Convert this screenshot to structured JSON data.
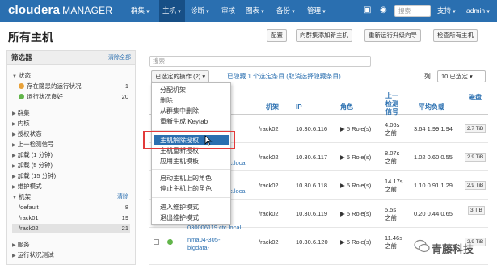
{
  "nav": {
    "brand_bold": "cloudera",
    "brand_rest": "MANAGER",
    "items": [
      "群集",
      "主机",
      "诊断",
      "审核",
      "图表",
      "备份",
      "管理"
    ],
    "search_placeholder": "搜索",
    "support": "支持",
    "user": "admin"
  },
  "page": {
    "title": "所有主机",
    "buttons": [
      "配置",
      "向群集添加新主机",
      "重新运行升级向导",
      "检查所有主机"
    ]
  },
  "sidebar": {
    "header": "筛选器",
    "clear_all": "清除全部",
    "status_label": "状态",
    "status_rows": [
      {
        "label": "存在隐患的运行状况",
        "count": "1",
        "color": "#e8a23a"
      },
      {
        "label": "运行状况良好",
        "count": "20",
        "color": "#62b54a"
      }
    ],
    "groups": [
      "群集",
      "内核",
      "授权状态",
      "上一检测信号",
      "加载 (1 分钟)",
      "加载 (5 分钟)",
      "加载 (15 分钟)",
      "维护模式"
    ],
    "rack_label": "机架",
    "rack_clear": "清除",
    "racks": [
      {
        "label": "/default",
        "count": "8"
      },
      {
        "label": "/rack01",
        "count": "19"
      },
      {
        "label": "/rack02",
        "count": "21"
      }
    ],
    "bottom_groups": [
      "服务",
      "运行状况测试"
    ]
  },
  "main": {
    "search_placeholder": "搜索",
    "actions_button": "已选定的操作 (2)",
    "selection_info": "已隐藏 1 个选定条目 (取消选择隐藏条目)",
    "columns_label": "列",
    "columns_select": "10 已选定"
  },
  "table": {
    "headers": [
      "机架",
      "IP",
      "角色",
      "上一检测信号",
      "平均负载",
      "磁盘"
    ],
    "rows": [
      {
        "host": "",
        "rack": "/rack02",
        "ip": "10.30.6.116",
        "roles": "5 Role(s)",
        "heartbeat": "4.06s 之前",
        "load": "3.64  1.99  1.94",
        "disk": "2.7 TiB"
      },
      {
        "host": "c.local",
        "rack": "/rack02",
        "ip": "10.30.6.117",
        "roles": "5 Role(s)",
        "heartbeat": "8.07s 之前",
        "load": "1.02  0.60  0.55",
        "disk": "2.9 TiB"
      },
      {
        "host": "c.local",
        "rack": "/rack02",
        "ip": "10.30.6.118",
        "roles": "5 Role(s)",
        "heartbeat": "14.17s 之前",
        "load": "1.10  0.91  1.29",
        "disk": "2.9 TiB"
      },
      {
        "host": "bigdata-030006119.ctc.local",
        "rack": "/rack02",
        "ip": "10.30.6.119",
        "roles": "5 Role(s)",
        "heartbeat": "5.5s 之前",
        "load": "0.20  0.44  0.65",
        "disk": "3 TiB"
      },
      {
        "host": "nma04-305-bigdata-",
        "rack": "/rack02",
        "ip": "10.30.6.120",
        "roles": "5 Role(s)",
        "heartbeat": "11.46s 之前",
        "load": "",
        "disk": "2.9 TiB"
      }
    ]
  },
  "dropdown": {
    "items": [
      "分配机架",
      "删除",
      "从群集中删除",
      "重新生成 Keytab",
      "主机解除授权",
      "主机重新授权",
      "应用主机模板",
      "启动主机上的角色",
      "停止主机上的角色",
      "进入维护模式",
      "退出维护模式"
    ]
  },
  "watermark": {
    "text": "青藤科技"
  },
  "colors": {
    "nav": "#2a6fb0",
    "link": "#2a6fb0",
    "highlight_box": "#e23a3a",
    "good": "#62b54a",
    "warn": "#e8a23a"
  }
}
